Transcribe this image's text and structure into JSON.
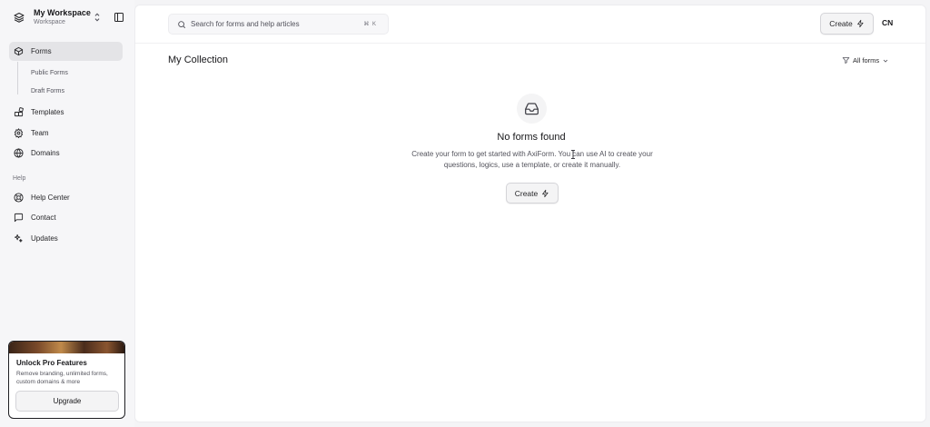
{
  "workspace": {
    "name": "My Workspace",
    "subtitle": "Workspace"
  },
  "sidebar": {
    "items": [
      {
        "label": "Forms",
        "icon": "box-icon",
        "active": true
      },
      {
        "label": "Templates",
        "icon": "blocks-icon"
      },
      {
        "label": "Team",
        "icon": "gear-icon"
      },
      {
        "label": "Domains",
        "icon": "globe-icon"
      }
    ],
    "subitems": [
      {
        "label": "Public Forms"
      },
      {
        "label": "Draft Forms"
      }
    ],
    "help_label": "Help",
    "help_items": [
      {
        "label": "Help Center",
        "icon": "lifebuoy-icon"
      },
      {
        "label": "Contact",
        "icon": "message-square-icon"
      },
      {
        "label": "Updates",
        "icon": "sparkles-icon"
      }
    ]
  },
  "promo": {
    "title": "Unlock Pro Features",
    "description": "Remove branding, unlimited forms, custom domains & more",
    "button_label": "Upgrade"
  },
  "topbar": {
    "search_placeholder": "Search for forms and help articles",
    "shortcut": "⌘ K",
    "create_label": "Create",
    "avatar_initials": "CN"
  },
  "main": {
    "title": "My Collection",
    "filter_label": "All forms",
    "empty_title": "No forms found",
    "empty_description": "Create your form to get started with AxiForm. You can use AI to create your questions, logics, use a template, or create it manually.",
    "create_label": "Create"
  },
  "colors": {
    "active_nav": "#e4e4e7",
    "text": "#18181b",
    "muted": "#71717a"
  }
}
